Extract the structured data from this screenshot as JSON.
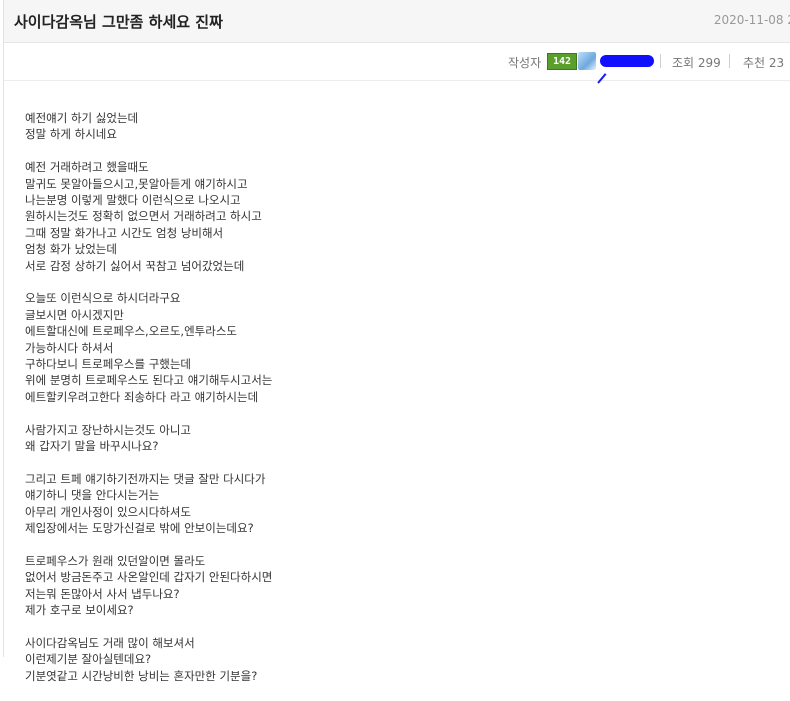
{
  "post": {
    "title": "사이다감옥님 그만좀 하세요 진짜",
    "date": "2020-11-08 2",
    "author_label": "작성자",
    "level_badge": "142",
    "views_label": "조회 299",
    "recommend_label": "추천 23"
  },
  "body": [
    [
      "예전얘기 하기 싫었는데",
      "정말 하게 하시네요"
    ],
    [
      "예전 거래하려고 했을때도",
      "말귀도 못알아들으시고,못알아듣게 얘기하시고",
      "나는분명 이렇게 말했다 이런식으로 나오시고",
      "원하시는것도 정확히 없으면서 거래하려고 하시고",
      "그때 정말 화가나고 시간도 엄청 낭비해서",
      "엄청 화가 났었는데",
      "서로 감정 상하기 싫어서 꾹참고 넘어갔었는데"
    ],
    [
      "오늘또 이런식으로 하시더라구요",
      "글보시면 아시겠지만",
      "에트할대신에 트로페우스,오르도,엔투라스도",
      "가능하시다 하셔서",
      "구하다보니 트로페우스를 구했는데",
      "위에 분명히 트로페우스도 된다고 얘기해두시고서는",
      "에트할키우려고한다 죄송하다 라고 얘기하시는데"
    ],
    [
      "사람가지고 장난하시는것도 아니고",
      "왜 갑자기 말을 바꾸시나요?"
    ],
    [
      "그리고 트페 얘기하기전까지는 댓글 잘만 다시다가",
      "얘기하니 댓을 안다시는거는",
      "아무리 개인사정이 있으시다하셔도",
      "제입장에서는 도망가신걸로 밖에 안보이는데요?"
    ],
    [
      "트로페우스가 원래 있던알이면 몰라도",
      "없어서 방금돈주고 사온알인데 갑자기 안된다하시면",
      "저는뭐 돈많아서 사서 냅두나요?",
      "제가 호구로 보이세요?"
    ],
    [
      "사이다감옥님도 거래 많이 해보셔서",
      "이런제기분 잘아실텐데요?",
      "기분엿같고 시간낭비한 낭비는 혼자만한 기분을?"
    ]
  ]
}
